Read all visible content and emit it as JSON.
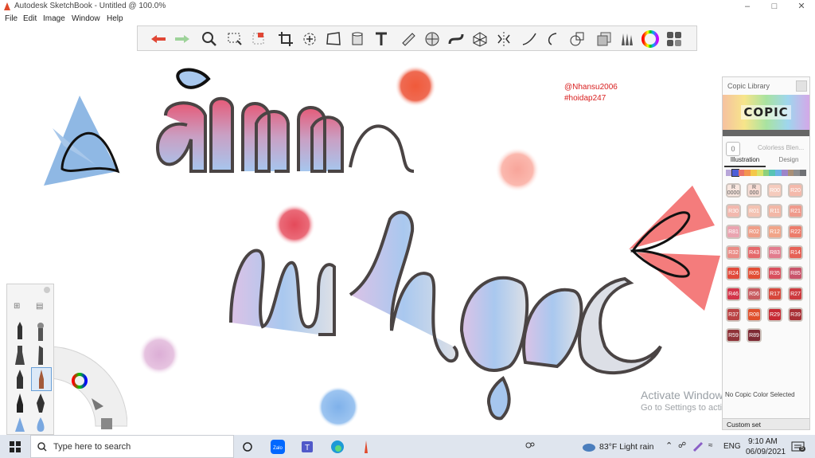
{
  "window": {
    "title": "Autodesk SketchBook - Untitled @ 100.0%",
    "minimize_icon": "minimize",
    "maximize_icon": "maximize",
    "close_icon": "close"
  },
  "menu": [
    "File",
    "Edit",
    "Image",
    "Window",
    "Help"
  ],
  "toolbar": {
    "tools": [
      "undo",
      "redo",
      "zoom",
      "select-rect",
      "lasso-select",
      "crop",
      "transform",
      "distort",
      "fill",
      "text",
      "ruler",
      "ellipse-guide",
      "french-curve",
      "perspective",
      "symmetry",
      "stroke",
      "predictive",
      "shape",
      "layers",
      "brush-library",
      "color-wheel",
      "copic"
    ]
  },
  "canvas": {
    "credit_1": "@Nhansu2006",
    "credit_2": "#hoidap247",
    "watermark_title": "Activate Windows",
    "watermark_sub": "Go to Settings to activate Windows."
  },
  "copic": {
    "title": "Copic Library",
    "logo": "COPIC",
    "colorless_code": "0",
    "colorless_label": "Colorless Blen...",
    "tab_illustration": "Illustration",
    "tab_design": "Design",
    "swatches": [
      {
        "code": "R 0000",
        "color": "#f8e6df"
      },
      {
        "code": "R 000",
        "color": "#f7dcd4"
      },
      {
        "code": "R00",
        "color": "#f5cbbd"
      },
      {
        "code": "R20",
        "color": "#f4b9ab"
      },
      {
        "code": "R30",
        "color": "#f2b8ae"
      },
      {
        "code": "R01",
        "color": "#f3c2b2"
      },
      {
        "code": "R11",
        "color": "#f2b7a6"
      },
      {
        "code": "R21",
        "color": "#ef9a8c"
      },
      {
        "code": "R81",
        "color": "#eaa4b0"
      },
      {
        "code": "R02",
        "color": "#ef9e88"
      },
      {
        "code": "R12",
        "color": "#f1a488"
      },
      {
        "code": "R22",
        "color": "#ec7c6b"
      },
      {
        "code": "R32",
        "color": "#ea8c86"
      },
      {
        "code": "R43",
        "color": "#e5696b"
      },
      {
        "code": "R83",
        "color": "#e27c8e"
      },
      {
        "code": "R14",
        "color": "#e66156"
      },
      {
        "code": "R24",
        "color": "#e14a3b"
      },
      {
        "code": "R05",
        "color": "#e24e34"
      },
      {
        "code": "R35",
        "color": "#d94f5d"
      },
      {
        "code": "R85",
        "color": "#c9546b"
      },
      {
        "code": "R46",
        "color": "#d3354a"
      },
      {
        "code": "R56",
        "color": "#c75a5f"
      },
      {
        "code": "R17",
        "color": "#d7473b"
      },
      {
        "code": "R27",
        "color": "#cd3a3f"
      },
      {
        "code": "R37",
        "color": "#b94243"
      },
      {
        "code": "R08",
        "color": "#e04f2b"
      },
      {
        "code": "R29",
        "color": "#c72a34"
      },
      {
        "code": "R39",
        "color": "#a83036"
      },
      {
        "code": "R59",
        "color": "#8f3339"
      },
      {
        "code": "R89",
        "color": "#7d2934"
      }
    ],
    "hue_bar": [
      "#b8a6d9",
      "#4e5fd8",
      "#e9726b",
      "#f39450",
      "#f4c74a",
      "#d9e36a",
      "#8ed07c",
      "#57c3b4",
      "#6cb0e4",
      "#9d84c9",
      "#a99077",
      "#8d8e90",
      "#6f7175"
    ],
    "status": "No Copic Color Selected",
    "custom_set": "Custom set"
  },
  "taskbar": {
    "search_placeholder": "Type here to search",
    "weather": "83°F  Light rain",
    "language": "ENG",
    "time": "9:10 AM",
    "date": "06/09/2021",
    "notification_count": "5"
  }
}
